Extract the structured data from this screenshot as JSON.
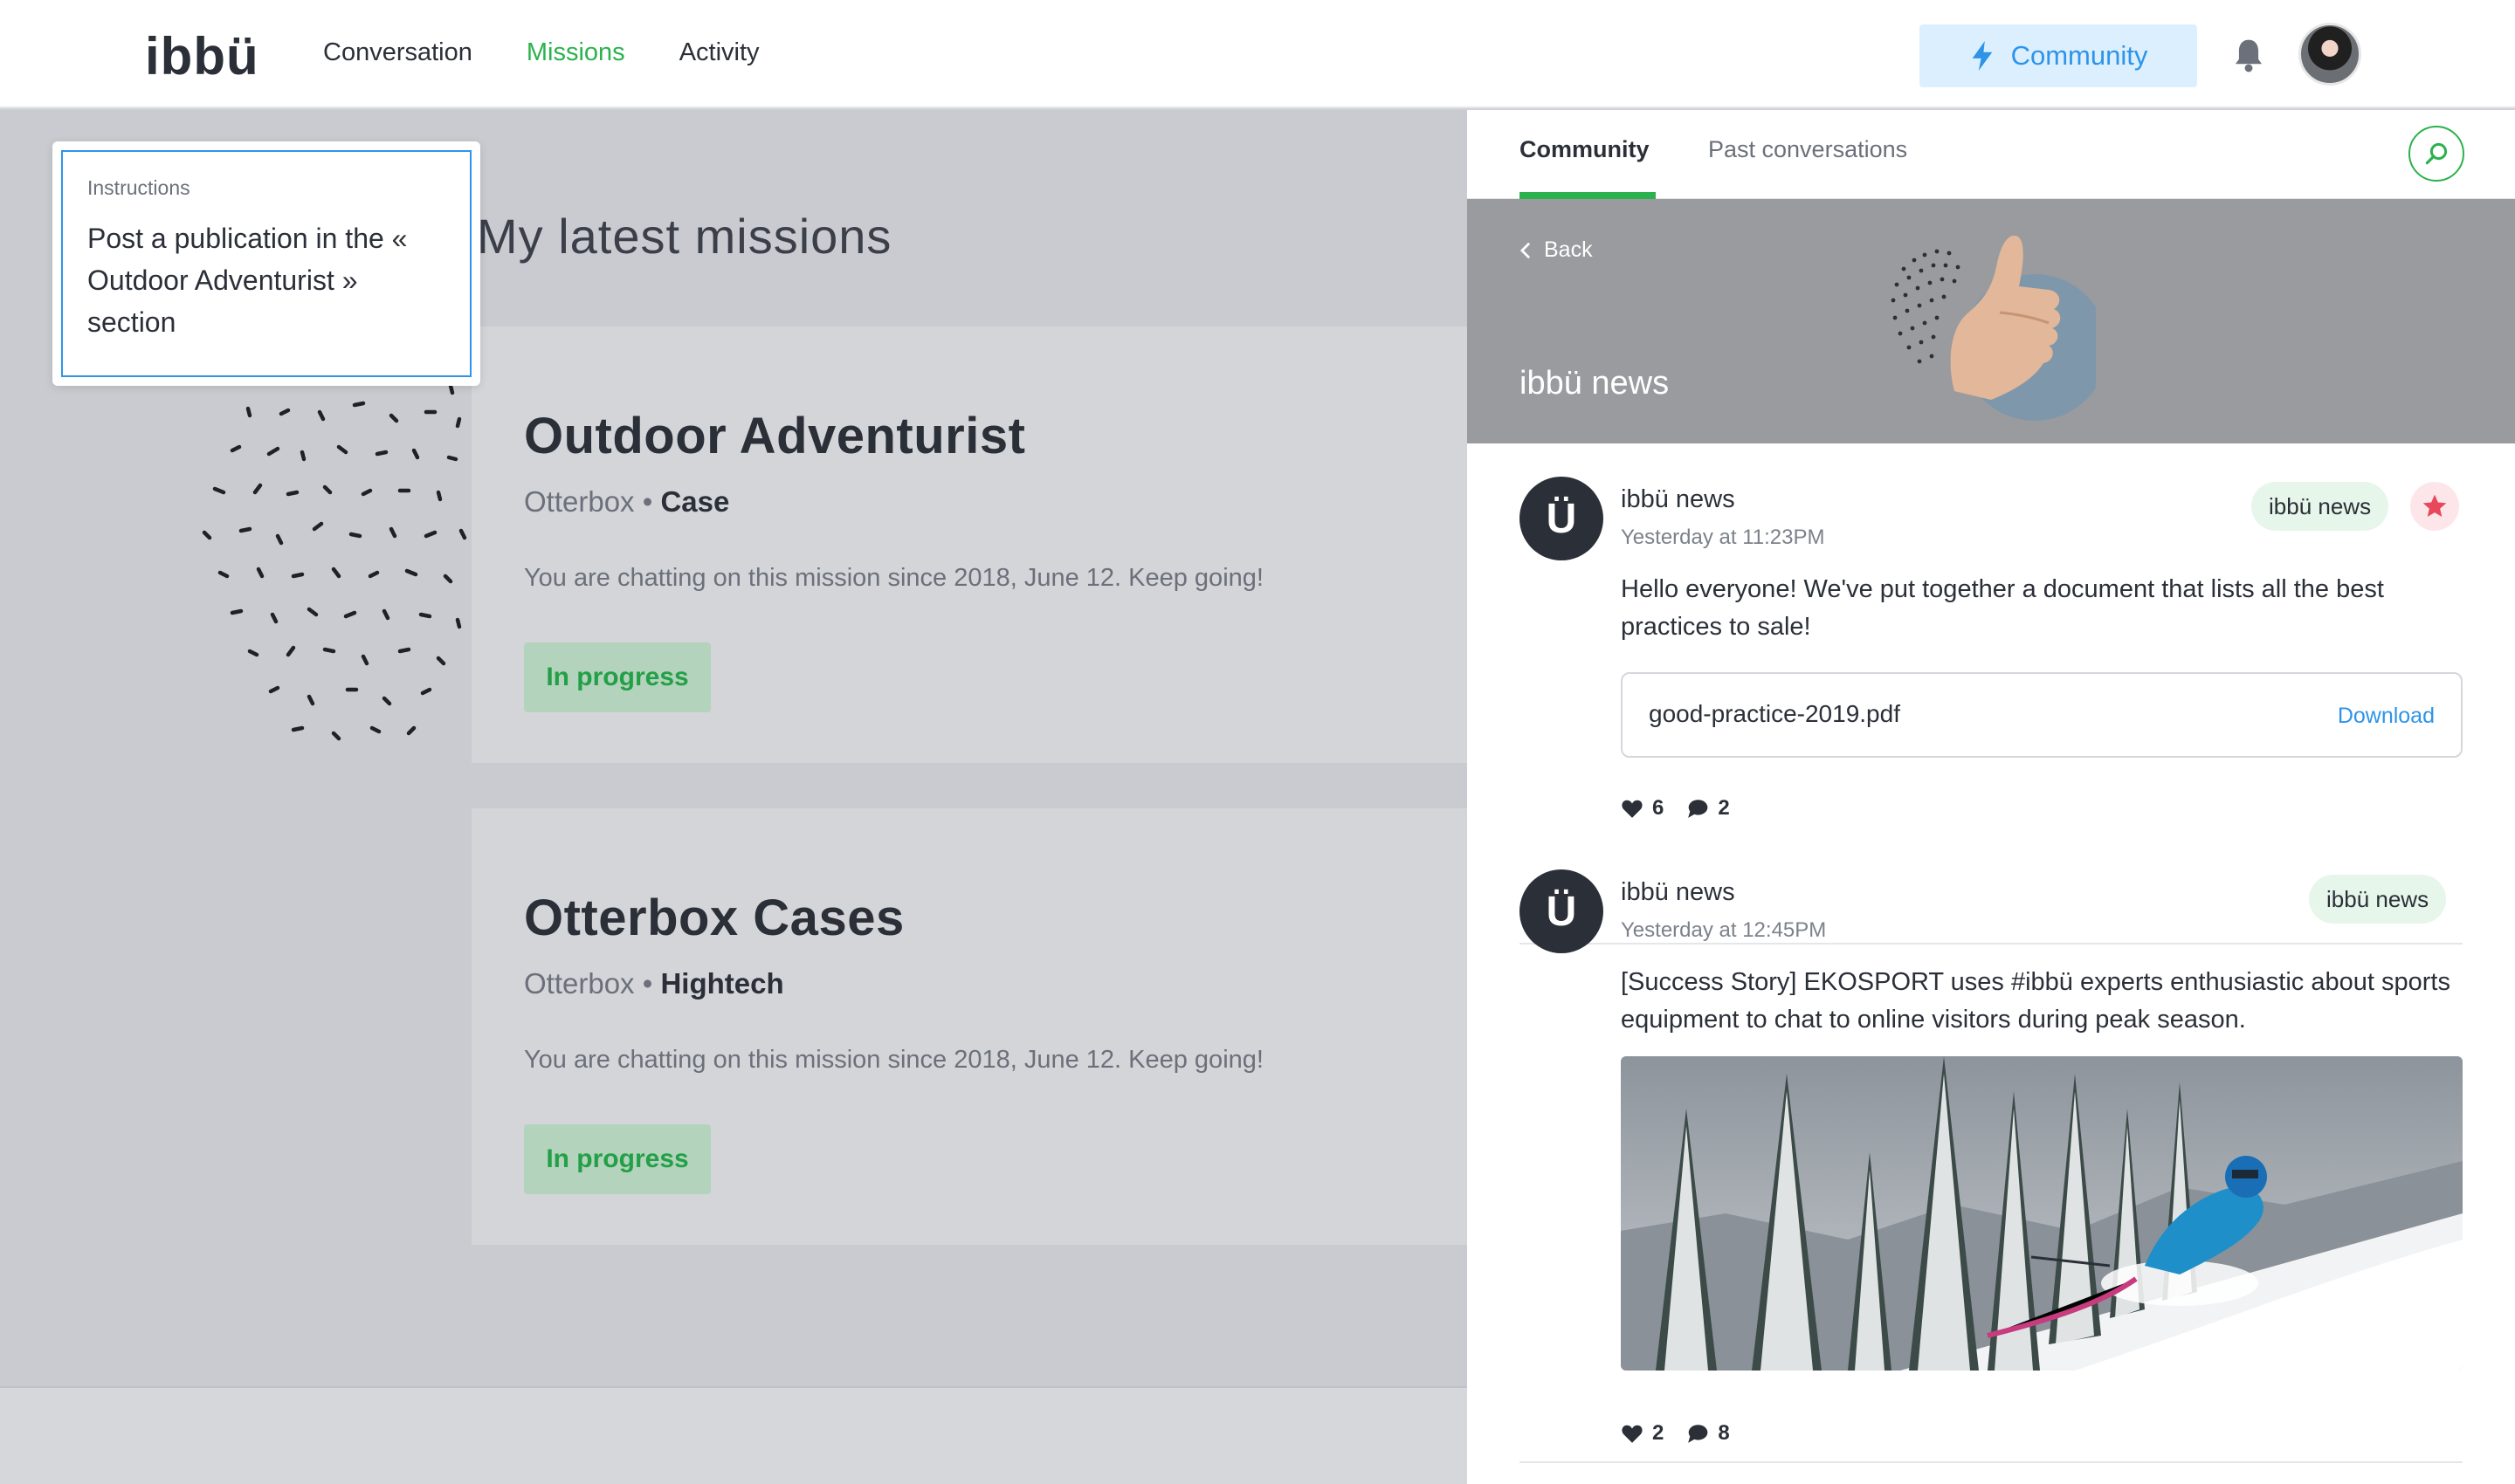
{
  "header": {
    "logo": "ibbü",
    "nav": [
      "Conversation",
      "Missions",
      "Activity"
    ],
    "active_nav": "Missions",
    "community_button": "Community",
    "icons": [
      "bolt-icon",
      "bell-icon",
      "avatar"
    ]
  },
  "main": {
    "title": "My latest missions",
    "missions": [
      {
        "name": "Outdoor Adventurist",
        "brand": "Otterbox",
        "separator": " • ",
        "category": "Case",
        "description": "You are chatting on this mission since 2018, June 12. Keep going!",
        "status": "In progress"
      },
      {
        "name": "Otterbox Cases",
        "brand": "Otterbox",
        "separator": " • ",
        "category": "Hightech",
        "description": "You are chatting on this mission since 2018, June 12. Keep going!",
        "status": "In progress"
      }
    ]
  },
  "instructions": {
    "label": "Instructions",
    "text": "Post a publication in the « Outdoor Adventurist » section"
  },
  "panel": {
    "tabs": [
      "Community",
      "Past conversations"
    ],
    "active_tab": "Community",
    "back_label": "Back",
    "channel_title": "ibbü news",
    "posts": [
      {
        "avatar_letter": "Ü",
        "author": "ibbü news",
        "time": "Yesterday at 11:23PM",
        "tag": "ibbü news",
        "starred": true,
        "text": "Hello everyone! We've put together a document that lists all the best practices to sale!",
        "attachment": {
          "name": "good-practice-2019.pdf",
          "action": "Download"
        },
        "likes": "6",
        "comments": "2"
      },
      {
        "avatar_letter": "Ü",
        "author": "ibbü news",
        "time": "Yesterday at 12:45PM",
        "tag": "ibbü news",
        "starred": false,
        "text": "[Success Story] EKOSPORT uses #ibbü experts enthusiastic about sports equipment to chat to online visitors during peak season.",
        "image": "skier-in-snowy-forest",
        "likes": "2",
        "comments": "8"
      }
    ]
  },
  "colors": {
    "brand_green": "#2bb24c",
    "accent_blue": "#2d94e8",
    "dark": "#2b2f38",
    "star_red": "#e9475a"
  }
}
